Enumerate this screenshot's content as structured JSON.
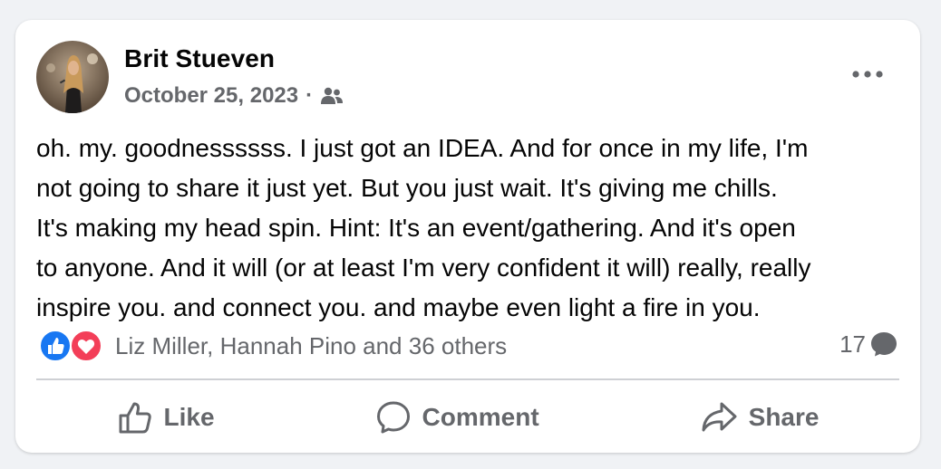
{
  "post": {
    "author": "Brit Stueven",
    "date": "October 25, 2023",
    "separator": "·",
    "audience_icon": "friends-icon",
    "more_icon": "more-options-icon",
    "text": "oh. my. goodnessssss. I just got an IDEA. And for once in my life, I'm\nnot going to share it just yet. But you just wait. It's giving me chills.\nIt's making my head spin. Hint: It's an event/gathering. And it's open\nto anyone. And it will (or at least I'm very confident it will) really, really\ninspire you. and connect you. and maybe even light a fire in you."
  },
  "reactions": {
    "icons": [
      "like-reaction-icon",
      "love-reaction-icon"
    ],
    "summary": "Liz Miller, Hannah Pino and 36 others",
    "comments_count": "17"
  },
  "actions": {
    "like_label": "Like",
    "comment_label": "Comment",
    "share_label": "Share"
  },
  "colors": {
    "like_blue": "#1877f2",
    "love_red": "#f33e58",
    "secondary_text": "#65676b",
    "primary_text": "#050505"
  }
}
